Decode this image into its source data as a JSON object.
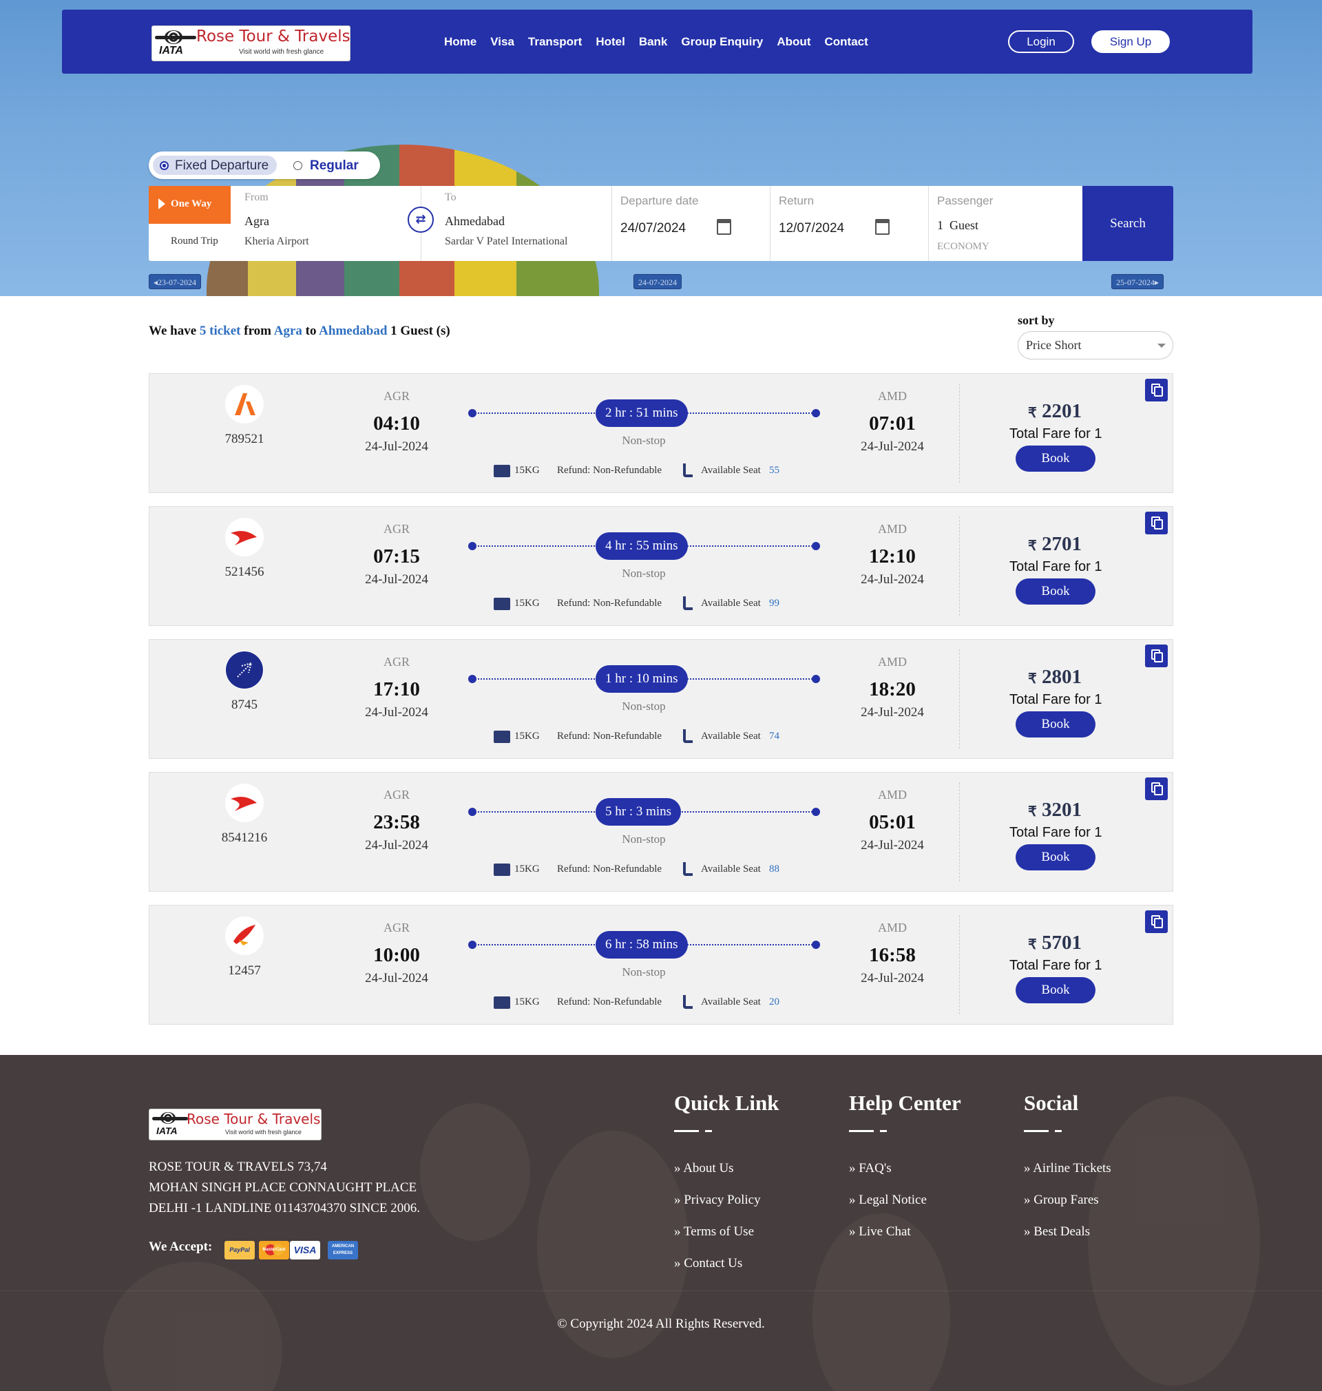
{
  "brand": {
    "name": "Rose Tour & Travels",
    "tagline": "Visit world with fresh glance",
    "iata": "IATA"
  },
  "nav": {
    "links": [
      "Home",
      "Visa",
      "Transport",
      "Hotel",
      "Bank",
      "Group Enquiry",
      "About",
      "Contact"
    ],
    "login": "Login",
    "signup": "Sign Up"
  },
  "search": {
    "fare_types": [
      "Fixed Departure",
      "Regular"
    ],
    "trip_types": [
      "One Way",
      "Round Trip"
    ],
    "from": {
      "label": "From",
      "city": "Agra",
      "airport": "Kheria Airport"
    },
    "to": {
      "label": "To",
      "city": "Ahmedabad",
      "airport": "Sardar V Patel International"
    },
    "departure": {
      "label": "Departure date",
      "value": "24/07/2024"
    },
    "return": {
      "label": "Return",
      "value": "12/07/2024"
    },
    "passenger": {
      "label": "Passenger",
      "value": "1  Guest",
      "class": "ECONOMY"
    },
    "button": "Search",
    "date_strip": [
      "23-07-2024",
      "24-07-2024",
      "25-07-2024"
    ]
  },
  "results": {
    "summary": {
      "p1": "We have",
      "count": "5 ticket",
      "p2": "from",
      "from": "Agra",
      "p3": "to",
      "to": "Ahmedabad",
      "p4": "1 Guest (s)"
    },
    "sort_label": "sort by",
    "sort_value": "Price Short",
    "fare_caption": "Total Fare for 1",
    "book_label": "Book",
    "nonstop": "Non-stop",
    "baggage": "15KG",
    "refund": "Refund: Non-Refundable",
    "seat_label": "Available Seat",
    "currency": "₹",
    "flights": [
      {
        "airline_icon": "orange-a-logo-icon",
        "flight_no": "789521",
        "from_code": "AGR",
        "dep_time": "04:10",
        "dep_date": "24-Jul-2024",
        "duration": "2 hr : 51 mins",
        "to_code": "AMD",
        "arr_time": "07:01",
        "arr_date": "24-Jul-2024",
        "seats": "55",
        "price": "2201"
      },
      {
        "airline_icon": "red-swoosh-logo-icon",
        "flight_no": "521456",
        "from_code": "AGR",
        "dep_time": "07:15",
        "dep_date": "24-Jul-2024",
        "duration": "4 hr : 55 mins",
        "to_code": "AMD",
        "arr_time": "12:10",
        "arr_date": "24-Jul-2024",
        "seats": "99",
        "price": "2701"
      },
      {
        "airline_icon": "blue-plane-logo-icon",
        "flight_no": "8745",
        "from_code": "AGR",
        "dep_time": "17:10",
        "dep_date": "24-Jul-2024",
        "duration": "1 hr : 10 mins",
        "to_code": "AMD",
        "arr_time": "18:20",
        "arr_date": "24-Jul-2024",
        "seats": "74",
        "price": "2801"
      },
      {
        "airline_icon": "red-swoosh-logo-icon",
        "flight_no": "8541216",
        "from_code": "AGR",
        "dep_time": "23:58",
        "dep_date": "24-Jul-2024",
        "duration": "5 hr : 3 mins",
        "to_code": "AMD",
        "arr_time": "05:01",
        "arr_date": "24-Jul-2024",
        "seats": "88",
        "price": "3201"
      },
      {
        "airline_icon": "red-bird-logo-icon",
        "flight_no": "12457",
        "from_code": "AGR",
        "dep_time": "10:00",
        "dep_date": "24-Jul-2024",
        "duration": "6 hr : 58 mins",
        "to_code": "AMD",
        "arr_time": "16:58",
        "arr_date": "24-Jul-2024",
        "seats": "20",
        "price": "5701"
      }
    ]
  },
  "footer": {
    "address": [
      "ROSE TOUR & TRAVELS 73,74",
      "MOHAN SINGH PLACE CONNAUGHT PLACE",
      "DELHI -1 LANDLINE 01143704370 SINCE 2006."
    ],
    "we_accept": "We Accept:",
    "payment_methods": [
      "PayPal",
      "MasterCard",
      "VISA",
      "AMERICAN EXPRESS"
    ],
    "columns": [
      {
        "title": "Quick Link",
        "links": [
          "About Us",
          "Privacy Policy",
          "Terms of Use",
          "Contact Us"
        ]
      },
      {
        "title": "Help Center",
        "links": [
          "FAQ's",
          "Legal Notice",
          "Live Chat"
        ]
      },
      {
        "title": "Social",
        "links": [
          "Airline Tickets",
          "Group Fares",
          "Best Deals"
        ]
      }
    ],
    "copyright": "© Copyright 2024 All Rights Reserved."
  },
  "colors": {
    "primary": "#2431a9",
    "accent_orange": "#f36f21",
    "link_blue": "#2f6fc0",
    "footer_bg": "#463d3e"
  }
}
